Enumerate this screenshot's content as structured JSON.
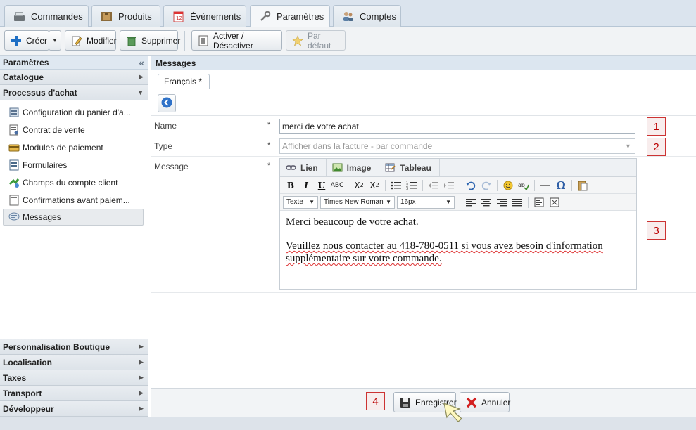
{
  "top_tabs": [
    {
      "label": "Commandes",
      "icon": "register-icon"
    },
    {
      "label": "Produits",
      "icon": "box-icon"
    },
    {
      "label": "Événements",
      "icon": "calendar-icon"
    },
    {
      "label": "Paramètres",
      "icon": "wrench-icon",
      "active": true
    },
    {
      "label": "Comptes",
      "icon": "users-icon"
    }
  ],
  "toolbar": {
    "create_label": "Créer",
    "modify_label": "Modifier",
    "delete_label": "Supprimer",
    "toggle_label": "Activer / Désactiver",
    "default_label": "Par défaut"
  },
  "sidebar": {
    "title": "Paramètres",
    "collapse_glyph": "«",
    "sections_top": [
      {
        "label": "Catalogue",
        "arrow": "▶"
      },
      {
        "label": "Processus d'achat",
        "arrow": "▼"
      }
    ],
    "items": [
      {
        "label": "Configuration du panier d'a...",
        "icon": "cart-config-icon"
      },
      {
        "label": "Contrat de vente",
        "icon": "contract-icon"
      },
      {
        "label": "Modules de paiement",
        "icon": "payment-icon"
      },
      {
        "label": "Formulaires",
        "icon": "form-icon"
      },
      {
        "label": "Champs du compte client",
        "icon": "client-fields-icon"
      },
      {
        "label": "Confirmations avant paiem...",
        "icon": "confirmation-icon"
      },
      {
        "label": "Messages",
        "icon": "message-icon",
        "selected": true
      }
    ],
    "sections_bottom": [
      {
        "label": "Personnalisation Boutique",
        "arrow": "▶"
      },
      {
        "label": "Localisation",
        "arrow": "▶"
      },
      {
        "label": "Taxes",
        "arrow": "▶"
      },
      {
        "label": "Transport",
        "arrow": "▶"
      },
      {
        "label": "Développeur",
        "arrow": "▶"
      }
    ]
  },
  "main": {
    "title": "Messages",
    "language_tab": "Français *",
    "form": {
      "name_label": "Name",
      "name_value": "merci de votre achat",
      "type_label": "Type",
      "type_placeholder": "Afficher dans la facture - par commande",
      "message_label": "Message",
      "required_mark": "*"
    },
    "editor": {
      "tabs": [
        {
          "label": "Lien",
          "icon": "link-icon"
        },
        {
          "label": "Image",
          "icon": "image-icon"
        },
        {
          "label": "Tableau",
          "icon": "table-icon"
        }
      ],
      "format_dropdown": "Texte",
      "font_dropdown": "Times New Roman",
      "size_dropdown": "16px",
      "content_line1": "Merci beaucoup de votre achat.",
      "content_line2": "Veuillez nous contacter au 418-780-0511 si vous avez besoin d'information supplémentaire sur votre commande."
    },
    "markers": [
      "1",
      "2",
      "3",
      "4"
    ]
  },
  "footer": {
    "save_label": "Enregistrer",
    "cancel_label": "Annuler"
  }
}
